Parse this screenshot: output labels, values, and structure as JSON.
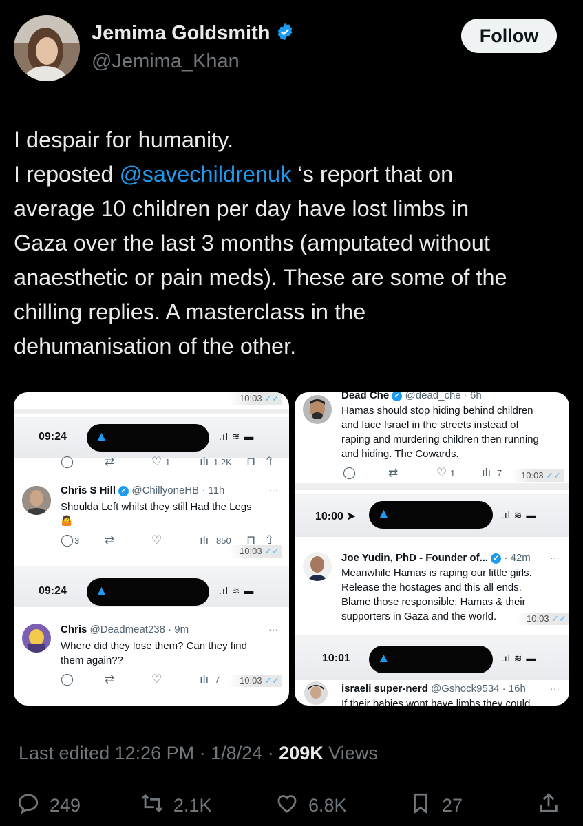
{
  "author": {
    "name": "Jemima Goldsmith",
    "handle": "@Jemima_Khan",
    "verified_icon": "verified-badge-icon"
  },
  "follow_label": "Follow",
  "tweet": {
    "line1": "I despair for humanity.",
    "line2_pre": "I reposted ",
    "line2_mention": "@savechildrenuk",
    "line2_post": " ‘s report that on",
    "line3": "average 10 children per day have lost limbs in",
    "line4": "Gaza over the last 3 months (amputated without",
    "line5": "anaesthetic or pain meds). These are some of the",
    "line6": "chilling replies. A masterclass in the",
    "line7": "dehumanisation of the other."
  },
  "media": {
    "left": {
      "top_stamp": "10:03",
      "status1_time": "09:24",
      "row1_like": "1",
      "row1_views": "1.2K",
      "tweet1": {
        "name": "Chris S Hill",
        "meta": "@ChillyoneHB · 11h",
        "text": "Shoulda Left whilst they still Had the Legs",
        "reply": "3",
        "views": "850",
        "stamp": "10:03"
      },
      "status2_time": "09:24",
      "tweet2": {
        "name": "Chris",
        "meta": "@Deadmeat238 · 9m",
        "text1": "Where did they lose them? Can they find",
        "text2": "them again??",
        "views": "7",
        "stamp": "10:03"
      }
    },
    "right": {
      "tweet1": {
        "name": "Dead Che",
        "meta": "@dead_che · 6h",
        "text1": "Hamas should stop hiding behind children",
        "text2": "and face Israel in the streets instead of",
        "text3": "raping and murdering children then running",
        "text4": "and hiding. The Cowards.",
        "like": "1",
        "views": "7",
        "stamp": "10:03"
      },
      "status1_time": "10:00",
      "tweet2": {
        "name": "Joe Yudin, PhD - Founder of...",
        "meta": "· 42m",
        "text1": "Meanwhile Hamas is raping our little girls.",
        "text2": "Release the hostages and this all ends.",
        "text3": "Blame those responsible: Hamas & their",
        "text4": "supporters in Gaza and the world.",
        "stamp": "10:03"
      },
      "status2_time": "10:01",
      "tweet3": {
        "name": "israeli super-nerd",
        "meta": "@Gshock9534 · 16h",
        "text1": "If their babies wont have limbs they could"
      }
    }
  },
  "footer": {
    "edited_prefix": "Last edited 12:26 PM · 1/8/24 · ",
    "views_count": "209K",
    "views_label": " Views",
    "replies": "249",
    "reposts": "2.1K",
    "likes": "6.8K",
    "bookmarks": "27"
  },
  "colors": {
    "background": "#000000",
    "text": "#e7e9ea",
    "muted": "#71767b",
    "accent": "#1d9bf0"
  }
}
